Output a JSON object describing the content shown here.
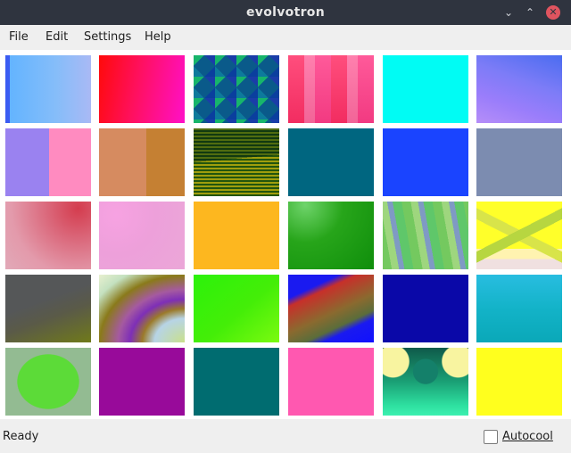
{
  "window": {
    "title": "evolvotron",
    "minimize_glyph": "⌄",
    "maximize_glyph": "⌃",
    "close_glyph": "✕"
  },
  "menu": {
    "items": [
      {
        "label": "File"
      },
      {
        "label": "Edit"
      },
      {
        "label": "Settings"
      },
      {
        "label": "Help"
      }
    ]
  },
  "status": {
    "text": "Ready"
  },
  "autocool": {
    "label": "Autocool",
    "checked": false
  },
  "colors": {
    "titlebar": "#2f343f",
    "close_button": "#e0545f",
    "grid_background": "#ffffff"
  }
}
